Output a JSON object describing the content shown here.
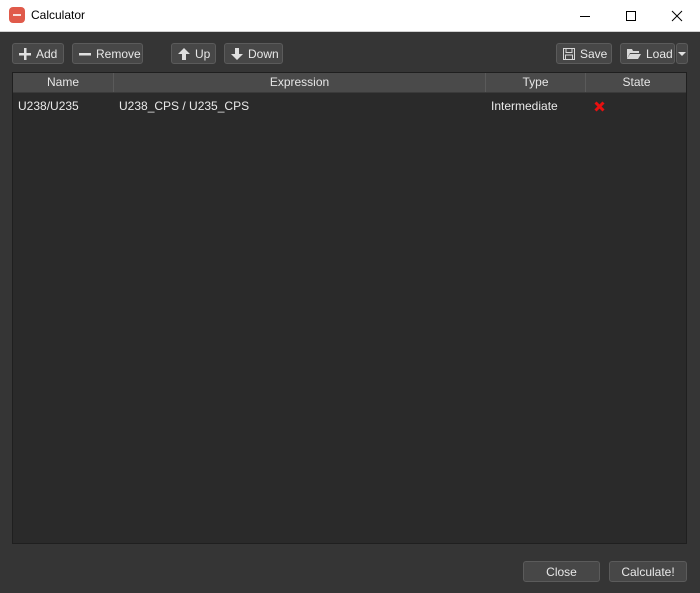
{
  "window": {
    "title": "Calculator",
    "icon": "app-logo-icon",
    "controls": {
      "minimize": "minimize-icon",
      "maximize": "maximize-icon",
      "close": "close-icon"
    }
  },
  "toolbar": {
    "add_label": "Add",
    "remove_label": "Remove",
    "up_label": "Up",
    "down_label": "Down",
    "save_label": "Save",
    "load_label": "Load"
  },
  "table": {
    "columns": [
      "Name",
      "Expression",
      "Type",
      "State"
    ],
    "rows": [
      {
        "name": "U238/U235",
        "expression": "U238_CPS / U235_CPS",
        "type": "Intermediate",
        "state": "error",
        "state_icon": "red-x-icon"
      }
    ]
  },
  "footer": {
    "close_label": "Close",
    "calculate_label": "Calculate!"
  },
  "colors": {
    "state_error": "#e81010",
    "app_icon": "#e05a4a"
  }
}
